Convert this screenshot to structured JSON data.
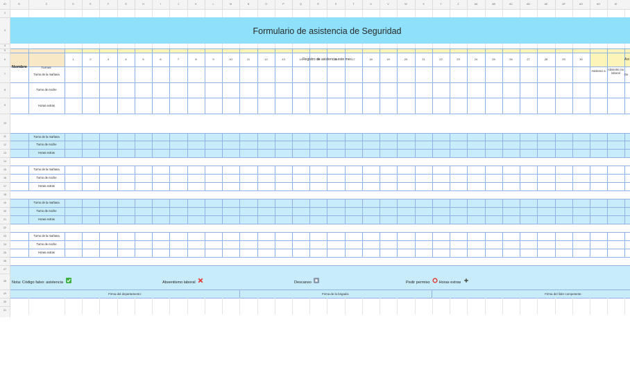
{
  "col_headers": [
    "ID",
    "B",
    "C",
    "D",
    "E",
    "F",
    "G",
    "H",
    "I",
    "J",
    "K",
    "L",
    "M",
    "N",
    "O",
    "P",
    "Q",
    "R",
    "S",
    "T",
    "U",
    "V",
    "W",
    "X",
    "Y",
    "Z",
    "AA",
    "AB",
    "AC",
    "AD",
    "AE",
    "AF",
    "AG",
    "AH",
    "AI"
  ],
  "row_headers": [
    "1",
    "2",
    "3",
    "4",
    "5",
    "6",
    "7",
    "8",
    "9",
    "10",
    "11",
    "12",
    "13",
    "14",
    "15",
    "16",
    "17",
    "18",
    "19",
    "20",
    "21",
    "22",
    "23",
    "24",
    "25",
    "26",
    "27",
    "28",
    "29",
    "30",
    "31"
  ],
  "title": "Formulario de asistencia de Seguridad",
  "headers": {
    "nombre": "Nombre",
    "turnos": "Turnos",
    "registro": "Registro de asistencia este mes",
    "registro_right": "Asi",
    "asistencia": "Asistenci a",
    "absentismo": "Absentis mo laboral",
    "de": "De"
  },
  "days": [
    "1",
    "2",
    "3",
    "4",
    "5",
    "6",
    "7",
    "8",
    "9",
    "10",
    "11",
    "12",
    "13",
    "14",
    "15",
    "16",
    "17",
    "18",
    "19",
    "20",
    "21",
    "22",
    "23",
    "24",
    "25",
    "26",
    "27",
    "28",
    "29",
    "30"
  ],
  "shifts": {
    "manana": "Turno de la mañana",
    "noche": "Turno de noche",
    "extras": "Horas extras"
  },
  "legend": {
    "nota": "Nota: Código falso: asistencia",
    "absentismo": "Absentismo laboral",
    "descanso": "Descanso",
    "permiso": "Pedir permiso",
    "extras": "Horas extras"
  },
  "signatures": {
    "departamento": "Firma del departamento:",
    "brigada": "Firma de la brigada:",
    "lider": "Firma del líder competente:"
  },
  "colors": {
    "title_bg": "#8ee0fb",
    "header_yellow": "#fdf4b7",
    "header_tan": "#f9e8c6",
    "band_blue": "#c9ecfa",
    "grid_blue": "#8fb3e6",
    "grid_gray": "#e4e4e4",
    "check_green": "#3cb043",
    "cross_red": "#e53935",
    "circle_red": "#e53935"
  },
  "icons": {
    "check": "check-mark-icon",
    "cross": "cross-mark-icon",
    "rest": "rest-square-icon",
    "circle": "circle-icon",
    "plus": "plus-icon"
  }
}
